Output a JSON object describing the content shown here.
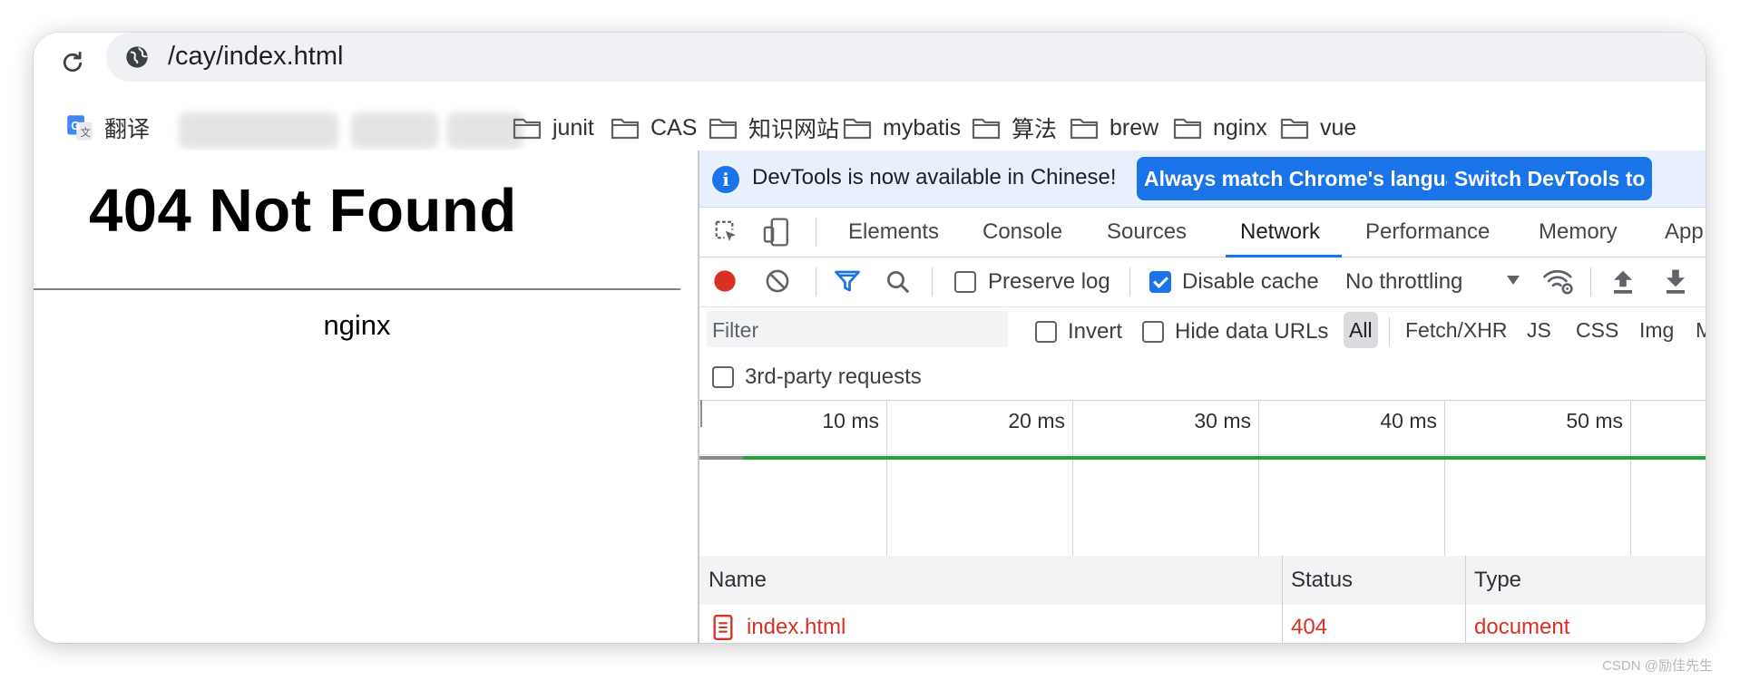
{
  "browser": {
    "url": "/cay/index.html",
    "bookmarks": [
      {
        "label": "翻译",
        "icon": "google-translate-icon"
      },
      {
        "label": "junit",
        "icon": "folder-icon"
      },
      {
        "label": "CAS",
        "icon": "folder-icon"
      },
      {
        "label": "知识网站",
        "icon": "folder-icon"
      },
      {
        "label": "mybatis",
        "icon": "folder-icon"
      },
      {
        "label": "算法",
        "icon": "folder-icon"
      },
      {
        "label": "brew",
        "icon": "folder-icon"
      },
      {
        "label": "nginx",
        "icon": "folder-icon"
      },
      {
        "label": "vue",
        "icon": "folder-icon"
      }
    ]
  },
  "page": {
    "heading": "404 Not Found",
    "server": "nginx"
  },
  "devtools": {
    "infobar": {
      "icon": "info-icon",
      "message": "DevTools is now available in Chinese!",
      "primary_button": "Always match Chrome's language",
      "secondary_button": "Switch DevTools to"
    },
    "tabs": [
      "Elements",
      "Console",
      "Sources",
      "Network",
      "Performance",
      "Memory",
      "App"
    ],
    "active_tab": "Network",
    "controls": {
      "preserve_log": "Preserve log",
      "disable_cache": "Disable cache",
      "disable_cache_checked": true,
      "preserve_log_checked": false,
      "throttling": "No throttling"
    },
    "filter": {
      "placeholder": "Filter",
      "invert": "Invert",
      "hide_data_urls": "Hide data URLs",
      "types": [
        "All",
        "Fetch/XHR",
        "JS",
        "CSS",
        "Img",
        "M"
      ],
      "active_type": "All",
      "third_party": "3rd-party requests"
    },
    "timeline": {
      "ticks": [
        "10 ms",
        "20 ms",
        "30 ms",
        "40 ms",
        "50 ms"
      ]
    },
    "table": {
      "columns": [
        "Name",
        "Status",
        "Type"
      ],
      "rows": [
        {
          "name": "index.html",
          "status": "404",
          "type": "document",
          "icon": "document-icon"
        }
      ]
    },
    "colors": {
      "accent": "#1a73e8",
      "error": "#d93025",
      "waterfall": "#21a53b",
      "record": "#d93025"
    }
  },
  "watermark": "CSDN @励佳先生"
}
